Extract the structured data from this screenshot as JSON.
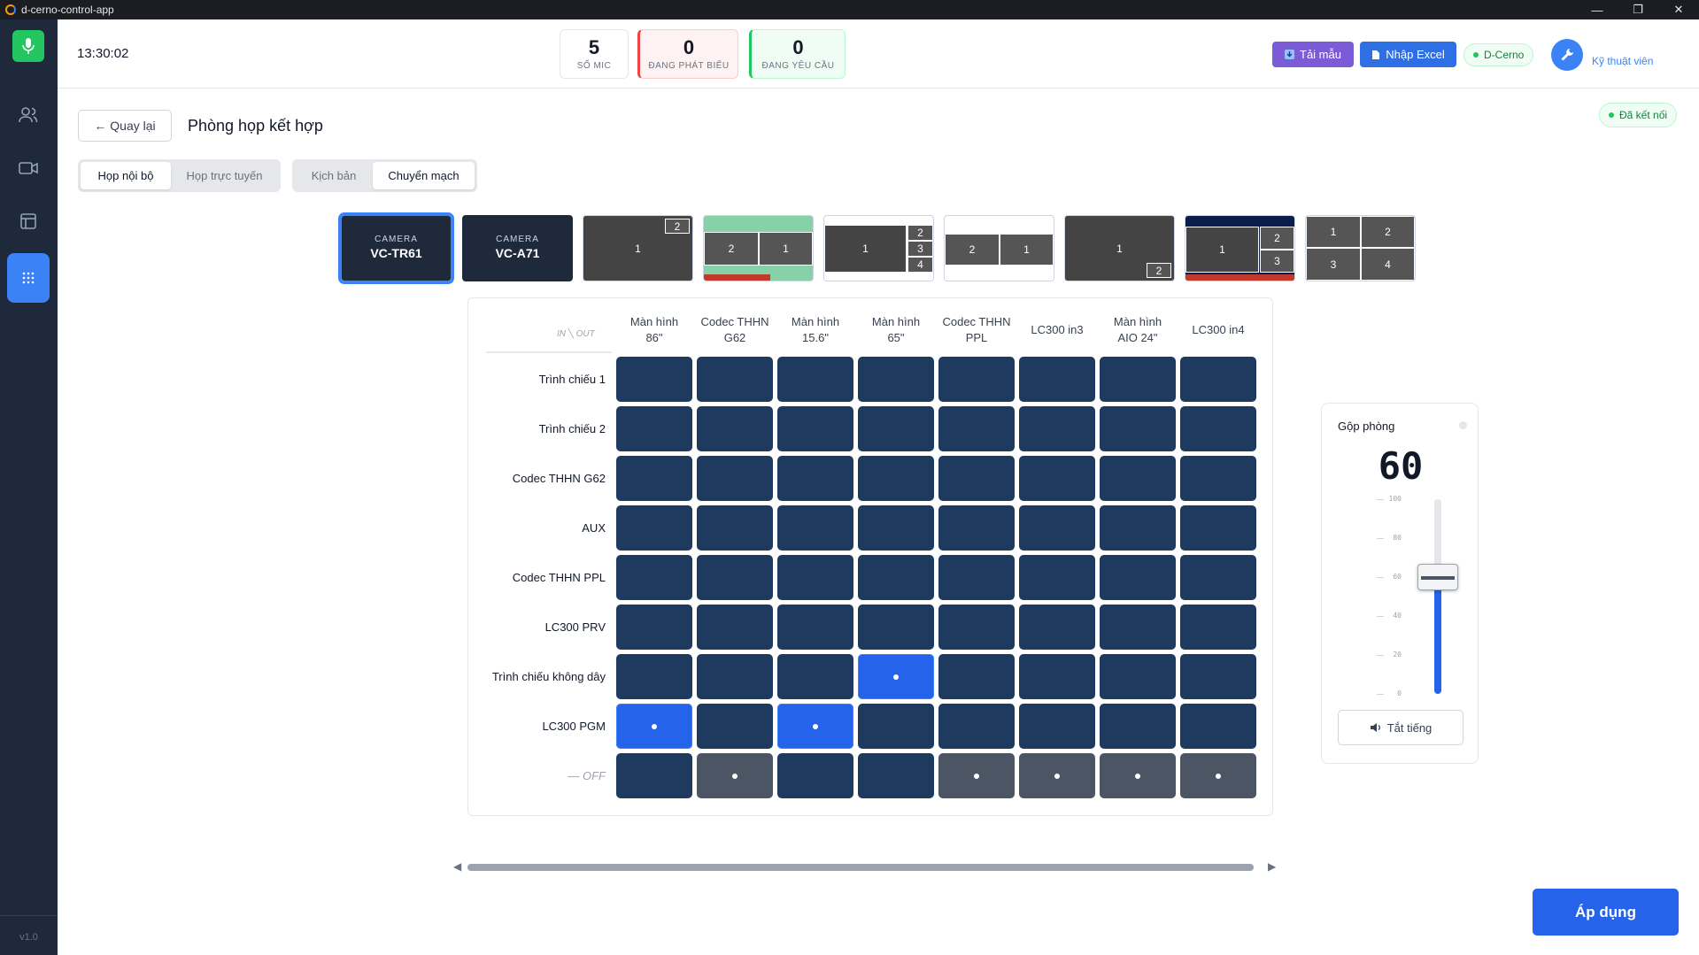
{
  "window": {
    "title": "d-cerno-control-app",
    "controls": {
      "minimize": "—",
      "maximize": "❐",
      "close": "✕"
    }
  },
  "sidebar": {
    "items": [
      {
        "icon": "mic-icon"
      },
      {
        "icon": "users-icon"
      },
      {
        "icon": "video-icon"
      },
      {
        "icon": "layout-icon"
      },
      {
        "icon": "grid-icon",
        "active": true
      }
    ],
    "version": "v1.0"
  },
  "header": {
    "clock": "13:30:02",
    "stats": [
      {
        "value": "5",
        "label": "SỐ MIC"
      },
      {
        "value": "0",
        "label": "ĐANG PHÁT BIỂU"
      },
      {
        "value": "0",
        "label": "ĐANG YÊU CẦU"
      }
    ],
    "download_label": "Tải mẫu",
    "import_label": "Nhập Excel",
    "device_label": "D-Cerno",
    "user_role": "Kỹ thuật viên"
  },
  "page": {
    "back_label": "← Quay lại",
    "title": "Phòng họp kết hợp",
    "connection_status": "Đã kết nối",
    "meeting_tabs": [
      "Họp nội bộ",
      "Họp trực tuyến"
    ],
    "mode_tabs": [
      "Kịch bản",
      "Chuyển mạch"
    ],
    "cameras": [
      {
        "label": "CAMERA",
        "name": "VC-TR61",
        "selected": true
      },
      {
        "label": "CAMERA",
        "name": "VC-A71",
        "selected": false
      }
    ],
    "layout_labels": [
      "1",
      "2",
      "3",
      "4"
    ]
  },
  "matrix": {
    "corner_label": "IN ╲ OUT",
    "outputs": [
      [
        "Màn hình",
        "86\""
      ],
      [
        "Codec THHN",
        "G62"
      ],
      [
        "Màn hình",
        "15.6\""
      ],
      [
        "Màn hình",
        "65\""
      ],
      [
        "Codec THHN",
        "PPL"
      ],
      [
        "LC300 in3",
        ""
      ],
      [
        "Màn hình",
        "AIO 24\""
      ],
      [
        "LC300 in4",
        ""
      ]
    ],
    "inputs": [
      "Trình chiếu 1",
      "Trình chiếu 2",
      "Codec THHN G62",
      "AUX",
      "Codec THHN PPL",
      "LC300 PRV",
      "Trình chiếu không dây",
      "LC300 PGM",
      "— OFF"
    ],
    "routes": [
      {
        "input": 6,
        "output": 3
      },
      {
        "input": 7,
        "output": 0
      },
      {
        "input": 7,
        "output": 2
      }
    ],
    "off_outputs": [
      1,
      4,
      5,
      6,
      7
    ]
  },
  "volume": {
    "title": "Gộp phòng",
    "value": "60",
    "level": 60,
    "ticks": [
      "100",
      "80",
      "60",
      "40",
      "20",
      "0"
    ],
    "mute_label": "Tắt tiếng"
  },
  "apply_label": "Áp dụng",
  "colors": {
    "accent": "#2563eb",
    "cell": "#1e3a5f",
    "sidebar": "#1e293b",
    "success": "#22c55e"
  }
}
